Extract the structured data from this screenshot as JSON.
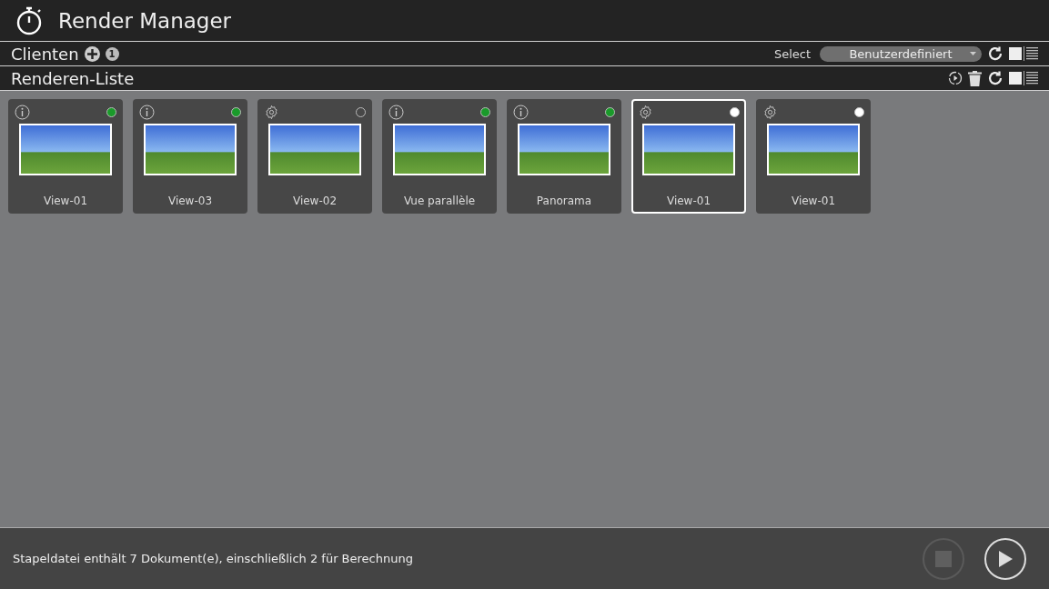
{
  "window": {
    "title": "Render Manager"
  },
  "clients": {
    "title": "Clienten",
    "count": "1",
    "select_label": "Select",
    "select_value": "Benutzerdefiniert"
  },
  "render_list": {
    "title": "Renderen-Liste",
    "items": [
      {
        "label": "View-01",
        "kind": "info",
        "color": "#1a9a2a",
        "selected": false
      },
      {
        "label": "View-03",
        "kind": "info",
        "color": "#1a9a2a",
        "selected": false
      },
      {
        "label": "View-02",
        "kind": "settings",
        "color": "#474747",
        "selected": false
      },
      {
        "label": "Vue parallèle",
        "kind": "info",
        "color": "#1a9a2a",
        "selected": false
      },
      {
        "label": "Panorama",
        "kind": "info",
        "color": "#1a9a2a",
        "selected": false
      },
      {
        "label": "View-01",
        "kind": "settings",
        "color": "#ffffff",
        "selected": true
      },
      {
        "label": "View-01",
        "kind": "settings",
        "color": "#ffffff",
        "selected": false
      }
    ]
  },
  "status_bar": {
    "message": "Stapeldatei enthält 7 Dokument(e), einschließlich 2 für Berechnung",
    "stop": {
      "disabled": true
    },
    "play": {
      "disabled": false
    }
  }
}
